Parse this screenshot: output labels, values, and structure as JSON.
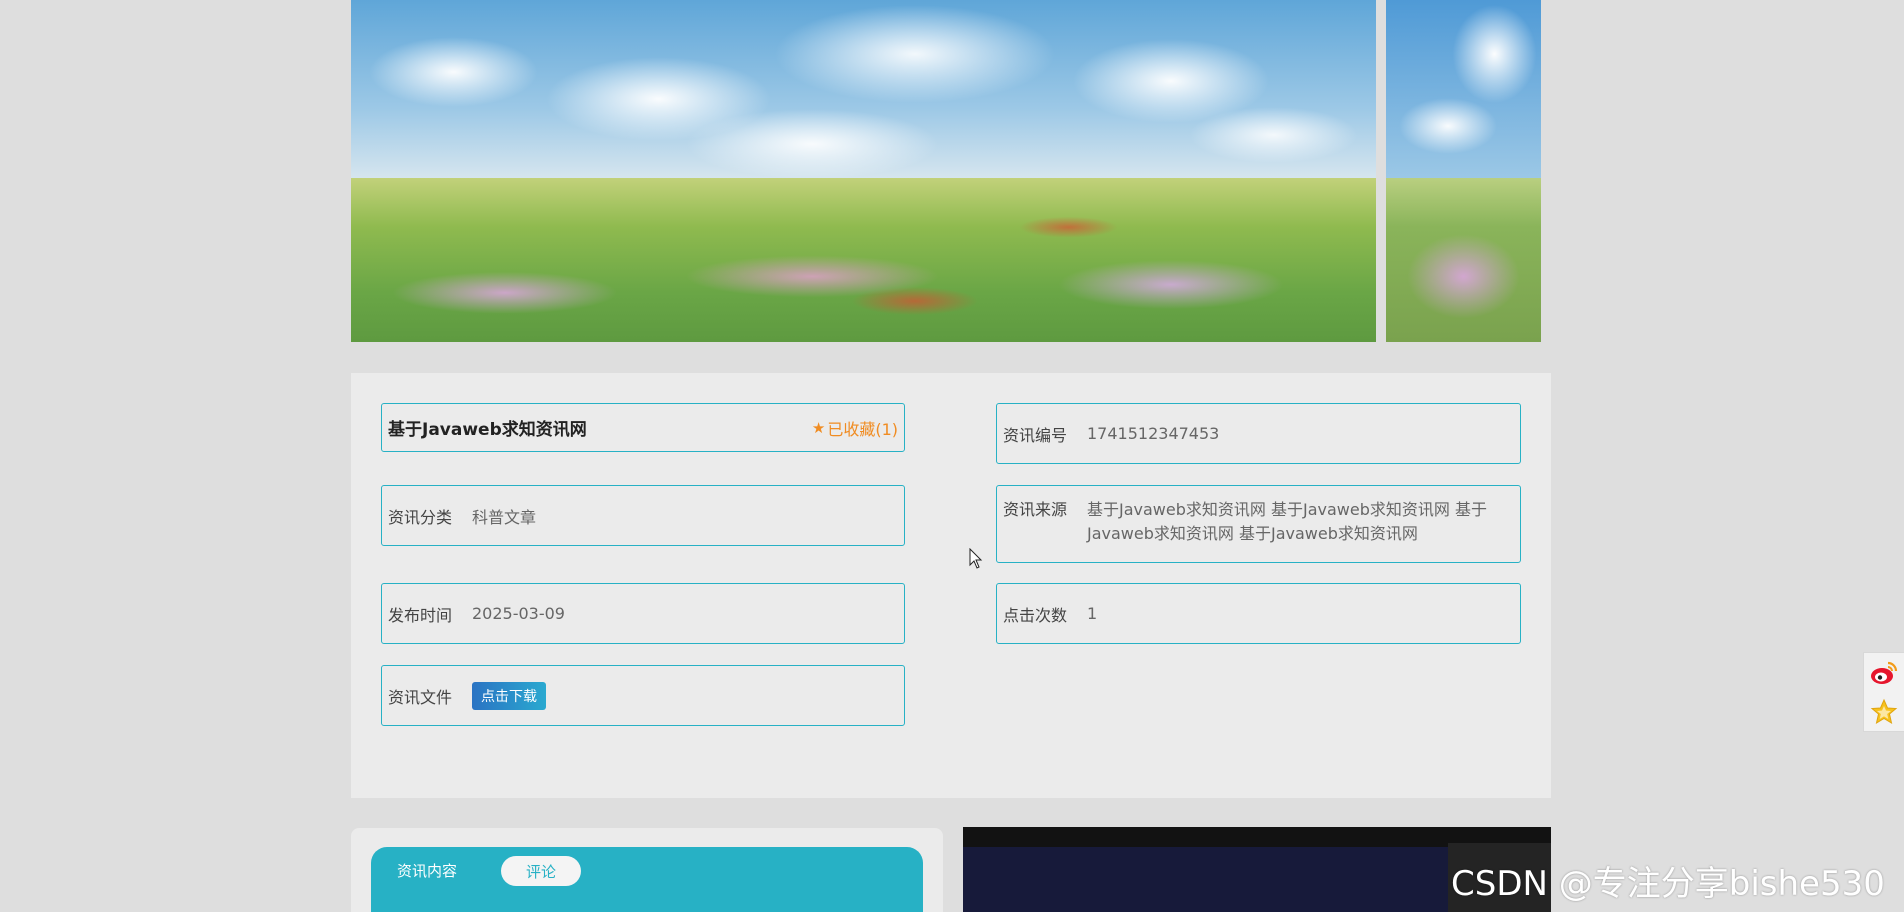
{
  "detail": {
    "title": "基于Javaweb求知资讯网",
    "favorite_label": "已收藏(1)",
    "fields": {
      "number": {
        "label": "资讯编号",
        "value": "1741512347453"
      },
      "category": {
        "label": "资讯分类",
        "value": "科普文章"
      },
      "source": {
        "label": "资讯来源",
        "value": "基于Javaweb求知资讯网 基于Javaweb求知资讯网 基于Javaweb求知资讯网 基于Javaweb求知资讯网"
      },
      "publish_time": {
        "label": "发布时间",
        "value": "2025-03-09"
      },
      "clicks": {
        "label": "点击次数",
        "value": "1"
      },
      "file": {
        "label": "资讯文件",
        "button": "点击下载"
      }
    }
  },
  "tabs": [
    {
      "label": "资讯内容",
      "active": true
    },
    {
      "label": "评论",
      "active": false
    }
  ],
  "watermark": "CSDN @专注分享bishe530",
  "share": {
    "icons": [
      "weibo-icon",
      "star-icon"
    ]
  },
  "colors": {
    "accent": "#27b1c5",
    "favorite": "#f08c22",
    "button": "#2a73c3"
  }
}
